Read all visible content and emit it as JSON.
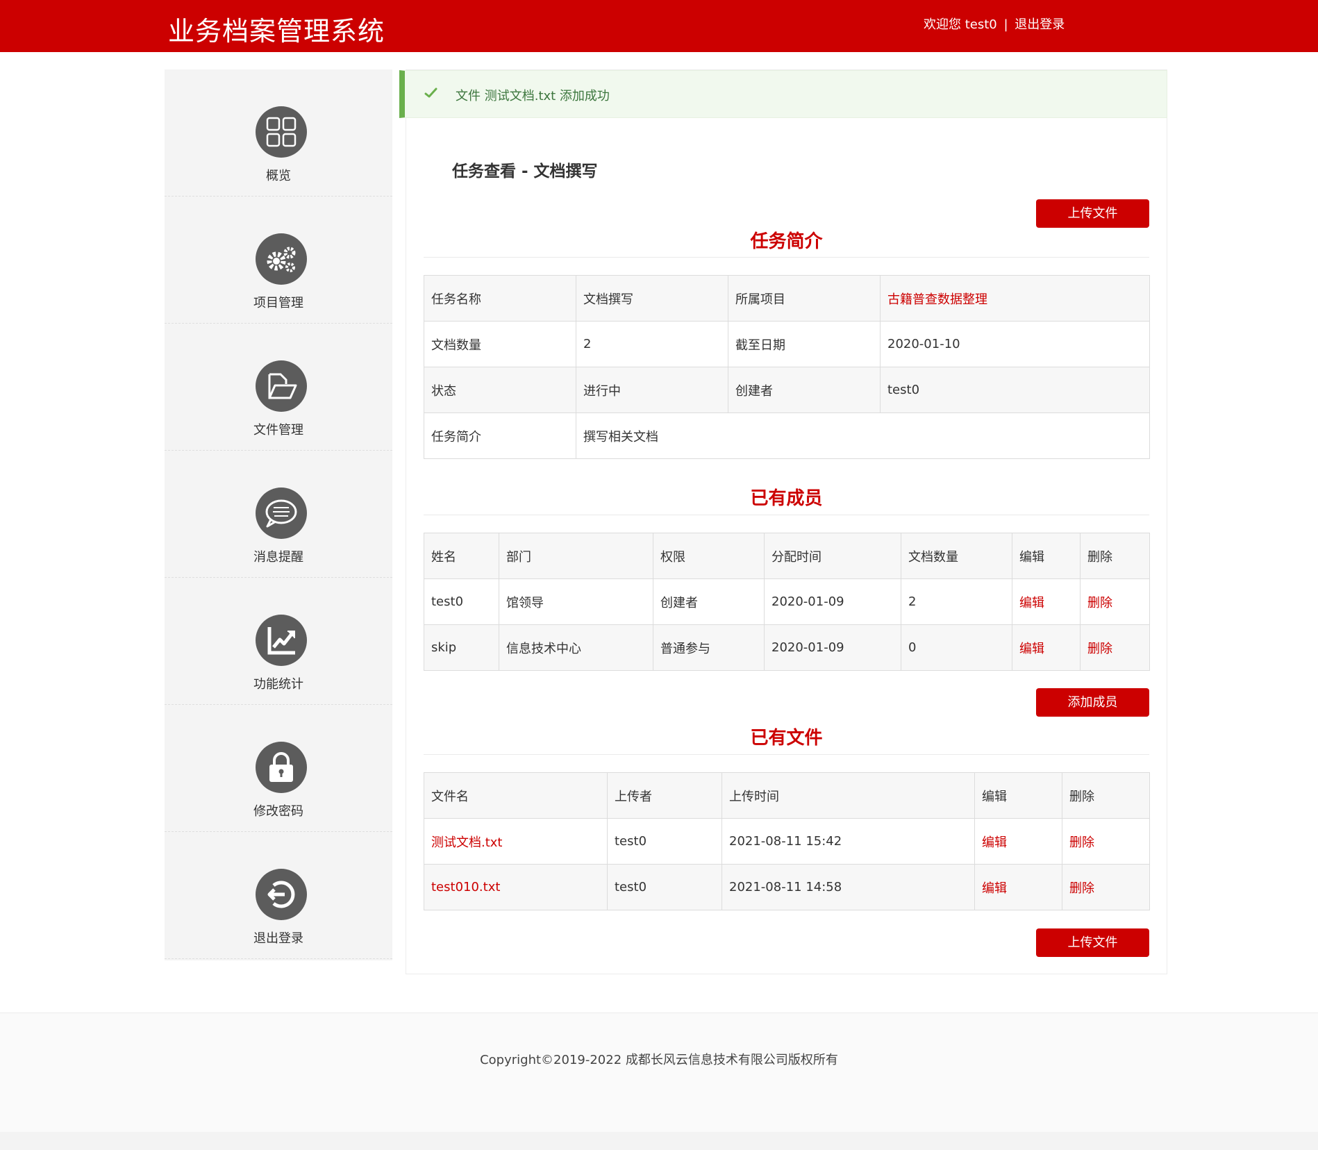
{
  "header": {
    "title": "业务档案管理系统",
    "welcome": "欢迎您 test0",
    "separator": "|",
    "logout": "退出登录"
  },
  "sidebar": {
    "items": [
      {
        "label": "概览",
        "icon": "grid-icon"
      },
      {
        "label": "项目管理",
        "icon": "gears-icon"
      },
      {
        "label": "文件管理",
        "icon": "folder-icon"
      },
      {
        "label": "消息提醒",
        "icon": "message-icon"
      },
      {
        "label": "功能统计",
        "icon": "chart-icon"
      },
      {
        "label": "修改密码",
        "icon": "lock-icon"
      },
      {
        "label": "退出登录",
        "icon": "logout-icon"
      }
    ]
  },
  "alert": {
    "message": "文件 测试文档.txt 添加成功",
    "icon": "check-icon"
  },
  "page_title": "任务查看 - 文档撰写",
  "buttons": {
    "upload_top": "上传文件",
    "add_member": "添加成员",
    "upload_bottom": "上传文件"
  },
  "task_info": {
    "heading": "任务简介",
    "rows": [
      [
        "任务名称",
        "文档撰写",
        "所属项目",
        "古籍普查数据整理"
      ],
      [
        "文档数量",
        "2",
        "截至日期",
        "2020-01-10"
      ],
      [
        "状态",
        "进行中",
        "创建者",
        "test0"
      ],
      [
        "任务简介",
        "撰写相关文档"
      ]
    ]
  },
  "members": {
    "heading": "已有成员",
    "headers": [
      "姓名",
      "部门",
      "权限",
      "分配时间",
      "文档数量",
      "编辑",
      "删除"
    ],
    "rows": [
      [
        "test0",
        "馆领导",
        "创建者",
        "2020-01-09",
        "2",
        "编辑",
        "删除"
      ],
      [
        "skip",
        "信息技术中心",
        "普通参与",
        "2020-01-09",
        "0",
        "编辑",
        "删除"
      ]
    ]
  },
  "files": {
    "heading": "已有文件",
    "headers": [
      "文件名",
      "上传者",
      "上传时间",
      "编辑",
      "删除"
    ],
    "rows": [
      [
        "测试文档.txt",
        "test0",
        "2021-08-11 15:42",
        "编辑",
        "删除"
      ],
      [
        "test010.txt",
        "test0",
        "2021-08-11 14:58",
        "编辑",
        "删除"
      ]
    ]
  },
  "footer": {
    "copyright": "Copyright©2019-2022 成都长风云信息技术有限公司版权所有"
  },
  "colors": {
    "brand_red": "#cc0000",
    "success_green": "#6ab04c",
    "sidebar_bg": "#f4f4f4",
    "icon_gray": "#5c5c5c"
  }
}
